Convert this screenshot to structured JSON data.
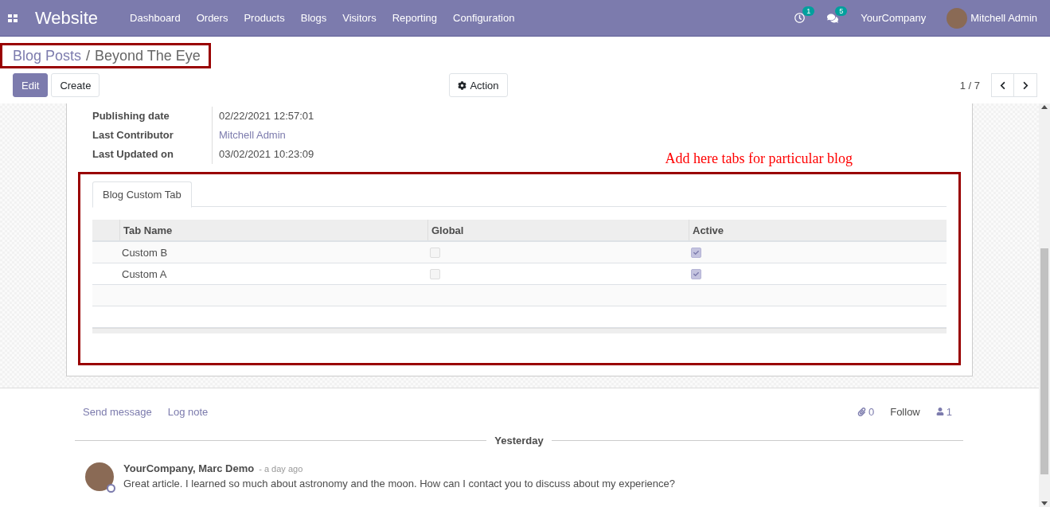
{
  "navbar": {
    "app_name": "Website",
    "menu": [
      "Dashboard",
      "Orders",
      "Products",
      "Blogs",
      "Visitors",
      "Reporting",
      "Configuration"
    ],
    "activity_count": "1",
    "message_count": "5",
    "company": "YourCompany",
    "user": "Mitchell Admin"
  },
  "breadcrumb": {
    "parent": "Blog Posts",
    "separator": "/",
    "current": "Beyond The Eye"
  },
  "buttons": {
    "edit": "Edit",
    "create": "Create",
    "action": "Action"
  },
  "pager": "1 / 7",
  "fields": [
    {
      "label": "Publishing date",
      "value": "02/22/2021 12:57:01",
      "kind": "text"
    },
    {
      "label": "Last Contributor",
      "value": "Mitchell Admin",
      "kind": "link"
    },
    {
      "label": "Last Updated on",
      "value": "03/02/2021 10:23:09",
      "kind": "text"
    }
  ],
  "annotation": "Add here tabs for particular blog",
  "notebook": {
    "tabs": [
      {
        "label": "Blog Custom Tab",
        "selected": true
      }
    ],
    "columns": [
      "Tab Name",
      "Global",
      "Active"
    ],
    "rows": [
      {
        "name": "Custom B",
        "global": false,
        "active": true
      },
      {
        "name": "Custom A",
        "global": false,
        "active": true
      }
    ]
  },
  "chatter": {
    "send_message": "Send message",
    "log_note": "Log note",
    "attachments": "0",
    "follow": "Follow",
    "followers": "1",
    "date_separator": "Yesterday",
    "messages": [
      {
        "author": "YourCompany, Marc Demo",
        "time": "- a day ago",
        "body": "Great article. I learned so much about astronomy and the moon. How can I contact you to discuss about my experience?"
      }
    ]
  }
}
